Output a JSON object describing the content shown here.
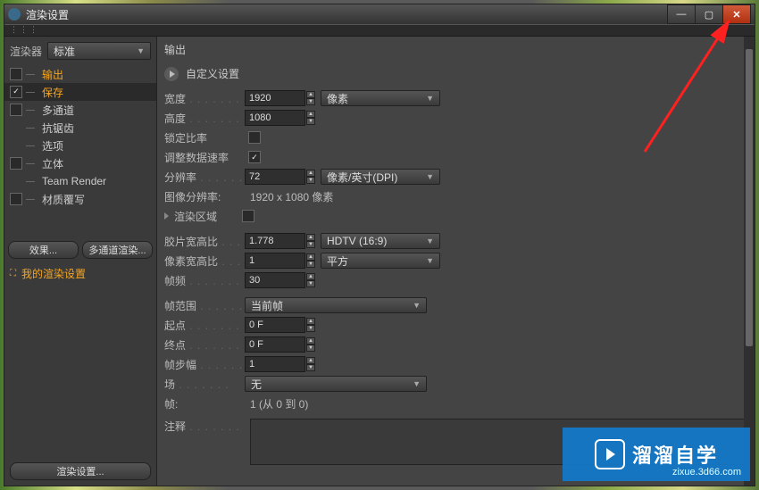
{
  "titlebar": {
    "title": "渲染设置"
  },
  "winbtns": {
    "min": "—",
    "max": "▢",
    "close": "✕"
  },
  "renderer": {
    "label": "渲染器",
    "value": "标准"
  },
  "sidebar": {
    "items": [
      {
        "label": "输出",
        "checked": false,
        "active": true
      },
      {
        "label": "保存",
        "checked": true,
        "highlight": true
      },
      {
        "label": "多通道",
        "checked": false
      },
      {
        "label": "抗锯齿"
      },
      {
        "label": "选项"
      },
      {
        "label": "立体",
        "checked": false
      },
      {
        "label": "Team Render"
      },
      {
        "label": "材质覆写",
        "checked": false
      }
    ],
    "effects_btn": "效果...",
    "multipass_btn": "多通道渲染...",
    "preset": "我的渲染设置",
    "render_setting_btn": "渲染设置..."
  },
  "main": {
    "header": "输出",
    "custom": "自定义设置",
    "rows": {
      "width": {
        "label": "宽度",
        "value": "1920",
        "unit": "像素"
      },
      "height": {
        "label": "高度",
        "value": "1080"
      },
      "lock": {
        "label": "锁定比率"
      },
      "adjust": {
        "label": "调整数据速率"
      },
      "res": {
        "label": "分辨率",
        "value": "72",
        "unit": "像素/英寸(DPI)"
      },
      "imgres": {
        "label": "图像分辨率:",
        "value": "1920 x 1080 像素"
      },
      "region": {
        "label": "渲染区域"
      },
      "film": {
        "label": "胶片宽高比",
        "value": "1.778",
        "unit": "HDTV (16:9)"
      },
      "pixel": {
        "label": "像素宽高比",
        "value": "1",
        "unit": "平方"
      },
      "fps": {
        "label": "帧频",
        "value": "30"
      },
      "range": {
        "label": "帧范围",
        "value": "当前帧"
      },
      "start": {
        "label": "起点",
        "value": "0 F"
      },
      "end": {
        "label": "终点",
        "value": "0 F"
      },
      "step": {
        "label": "帧步幅",
        "value": "1"
      },
      "field": {
        "label": "场",
        "value": "无"
      },
      "frames": {
        "label": "帧:",
        "value": "1 (从 0 到 0)"
      },
      "notes": {
        "label": "注释"
      }
    }
  },
  "watermark": {
    "text": "溜溜自学",
    "sub": "zixue.3d66.com"
  }
}
